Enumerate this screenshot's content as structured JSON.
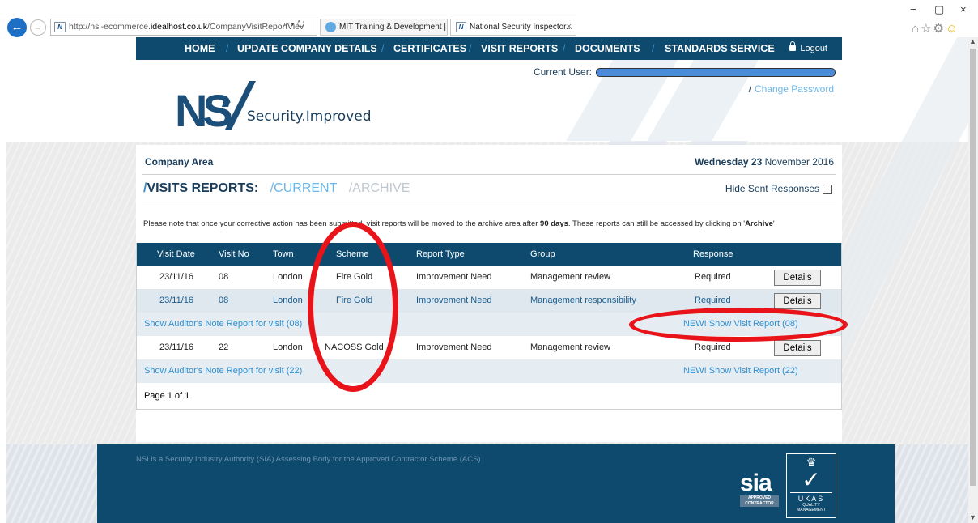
{
  "browser": {
    "url_prefix": "http://nsi-ecommerce.",
    "url_domain": "idealhost.co.uk",
    "url_suffix": "/CompanyVisitReportViev",
    "addr_icons": "⌕ ▾ ↻",
    "tabs": [
      {
        "label": "MIT Training & Development | ..."
      },
      {
        "label": "National Security Inspector..."
      }
    ],
    "tab_close": "×",
    "win_min": "−",
    "win_max": "▢",
    "win_close": "×",
    "favicon": "N"
  },
  "nav": {
    "items": [
      "HOME",
      "UPDATE COMPANY DETAILS",
      "CERTIFICATES",
      "VISIT REPORTS",
      "DOCUMENTS",
      "STANDARDS SERVICE"
    ],
    "sep": "/",
    "logout": "Logout"
  },
  "header": {
    "logo_text": "Security.Improved",
    "current_user_label": "Current User:",
    "change_password_slash": "/",
    "change_password": "Change Password"
  },
  "content": {
    "company_area": "Company Area",
    "date_bold": "Wednesday 23",
    "date_rest": " November 2016",
    "title_slash": "/",
    "title": "VISITS REPORTS:",
    "current": "/CURRENT",
    "archive": "/ARCHIVE",
    "hide_sent": "Hide Sent Responses",
    "note_pre": "Please note that once your corrective action has been submitted, visit reports will be moved to the archive area after ",
    "note_days": "90 days",
    "note_mid": ". These reports can still be accessed by clicking on '",
    "note_archive": "Archive",
    "note_end": "'"
  },
  "table": {
    "headers": [
      "Visit Date",
      "Visit No",
      "Town",
      "Scheme",
      "Report Type",
      "Group",
      "Response"
    ],
    "rows": [
      {
        "date": "23/11/16",
        "no": "08",
        "town": "London",
        "scheme": "Fire Gold",
        "type": "Improvement Need",
        "group": "Management review",
        "response": "Required",
        "btn": "Details"
      },
      {
        "date": "23/11/16",
        "no": "08",
        "town": "London",
        "scheme": "Fire Gold",
        "type": "Improvement Need",
        "group": "Management responsibility",
        "response": "Required",
        "btn": "Details"
      },
      {
        "date": "23/11/16",
        "no": "22",
        "town": "London",
        "scheme": "NACOSS Gold",
        "type": "Improvement Need",
        "group": "Management review",
        "response": "Required",
        "btn": "Details"
      }
    ],
    "link_rows": [
      {
        "auditor": "Show Auditor's Note Report for visit (08)",
        "visit": "NEW! Show Visit Report (08)"
      },
      {
        "auditor": "Show Auditor's Note Report for visit (22)",
        "visit": "NEW! Show Visit Report (22)"
      }
    ],
    "page": "Page 1 of 1"
  },
  "footer": {
    "text": "NSI is a Security Industry Authority (SIA) Assessing Body for the Approved Contractor Scheme (ACS)",
    "sia": "sia",
    "sia_sub1": "APPROVED",
    "sia_sub2": "CONTRACTOR",
    "ukas": "UKAS",
    "ukas_sub1": "QUALITY",
    "ukas_sub2": "MANAGEMENT"
  },
  "colors": {
    "nav_bg": "#0d4a6e",
    "accent": "#5aa6db",
    "annotation": "#e8141a"
  }
}
